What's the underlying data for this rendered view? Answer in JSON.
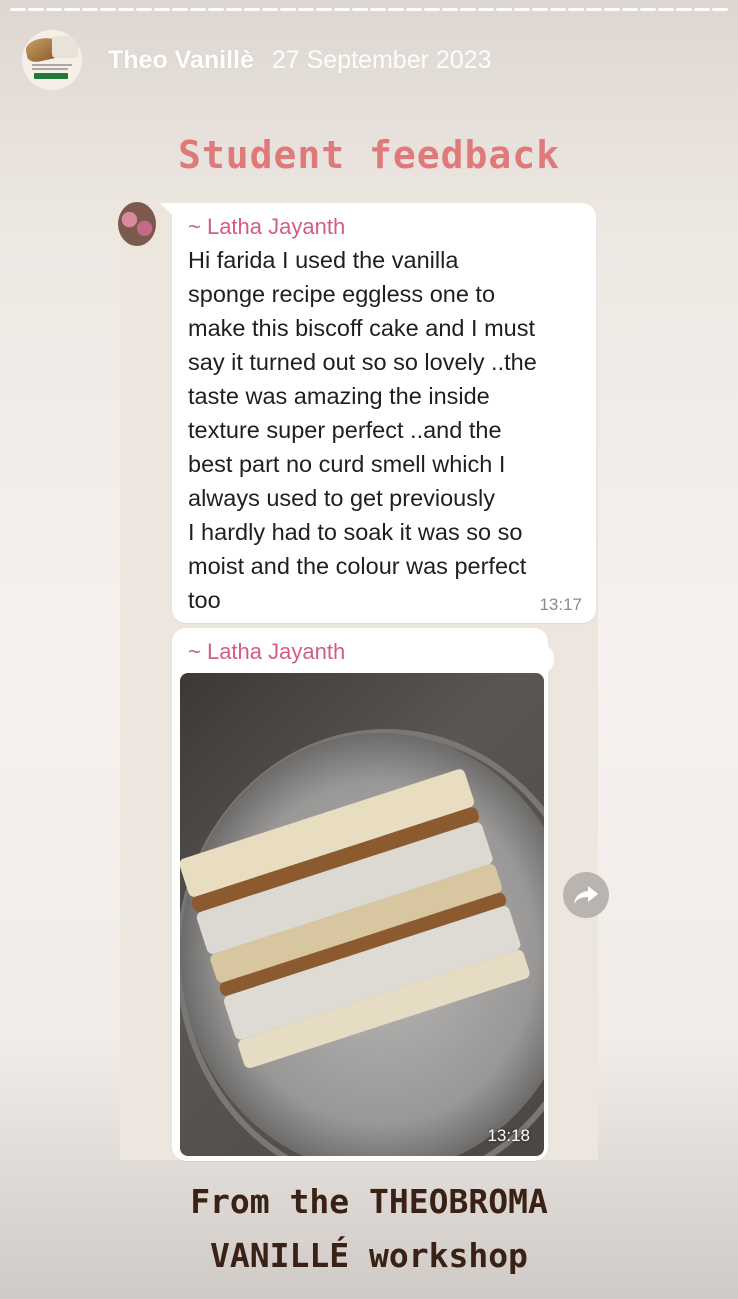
{
  "story": {
    "user_name": "Theo Vanillè",
    "post_date": "27 September 2023",
    "title": "Student feedback",
    "footer_lines": [
      "From the THEOBROMA",
      "VANILLÉ workshop"
    ]
  },
  "chat": {
    "messages": [
      {
        "sender": "~ Latha Jayanth",
        "lines": [
          "Hi farida  I used the vanilla",
          "sponge recipe eggless one to",
          "make this biscoff cake and I must",
          "say it turned out so so lovely ..the",
          "taste was amazing the inside",
          "texture super perfect ..and the",
          "best part no curd smell which I",
          "always used to get previously",
          "I hardly had to soak it was so so",
          "moist and the colour was perfect",
          "too"
        ],
        "time": "13:17"
      },
      {
        "sender": "~ Latha Jayanth",
        "image": "cake-slice-photo",
        "time": "13:18"
      }
    ]
  },
  "icons": {
    "share": "share-forward-icon",
    "avatar": "profile-avatar"
  },
  "colors": {
    "title": "#e07a7a",
    "sender": "#d45c84",
    "footer": "#3a2116"
  }
}
